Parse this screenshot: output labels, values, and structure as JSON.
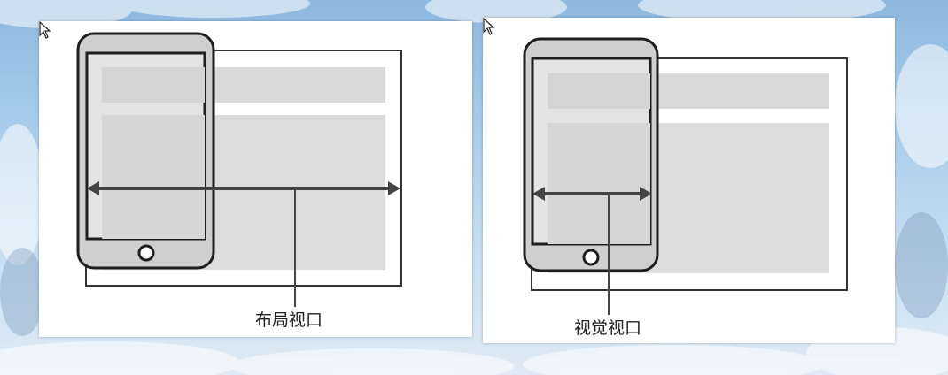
{
  "diagrams": [
    {
      "label": "布局视口"
    },
    {
      "label": "视觉视口"
    }
  ],
  "icons": {
    "cursor": "mouse-pointer-icon",
    "phone": "smartphone-icon",
    "arrow": "double-arrow-icon"
  },
  "colors": {
    "outline": "#333333",
    "content_block": "#d9d9d9",
    "phone_body": "#cfcfcf",
    "sky_top": "#8db8de",
    "sky_bottom": "#dfeaf5"
  }
}
